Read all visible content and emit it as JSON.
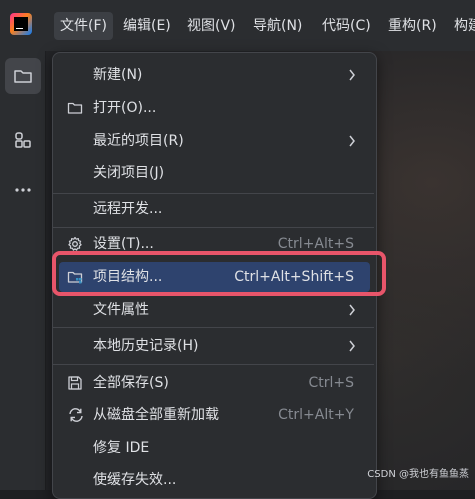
{
  "menubar": {
    "tabs": [
      "文件(F)",
      "编辑(E)",
      "视图(V)",
      "导航(N)",
      "代码(C)",
      "重构(R)",
      "构建"
    ]
  },
  "dropdown": {
    "items": [
      {
        "label": "新建(N)",
        "shortcut": "",
        "submenu": true,
        "icon": ""
      },
      {
        "label": "打开(O)...",
        "shortcut": "",
        "submenu": false,
        "icon": "folder-icon"
      },
      {
        "label": "最近的项目(R)",
        "shortcut": "",
        "submenu": true,
        "icon": ""
      },
      {
        "label": "关闭项目(J)",
        "shortcut": "",
        "submenu": false,
        "icon": ""
      },
      {
        "label": "远程开发...",
        "shortcut": "",
        "submenu": false,
        "icon": ""
      },
      {
        "label": "设置(T)...",
        "shortcut": "Ctrl+Alt+S",
        "submenu": false,
        "icon": "gear-icon"
      },
      {
        "label": "项目结构...",
        "shortcut": "Ctrl+Alt+Shift+S",
        "submenu": false,
        "icon": "project-structure-icon"
      },
      {
        "label": "文件属性",
        "shortcut": "",
        "submenu": true,
        "icon": ""
      },
      {
        "label": "本地历史记录(H)",
        "shortcut": "",
        "submenu": true,
        "icon": ""
      },
      {
        "label": "全部保存(S)",
        "shortcut": "Ctrl+S",
        "submenu": false,
        "icon": "save-icon"
      },
      {
        "label": "从磁盘全部重新加载",
        "shortcut": "Ctrl+Alt+Y",
        "submenu": false,
        "icon": "reload-icon"
      },
      {
        "label": "修复 IDE",
        "shortcut": "",
        "submenu": false,
        "icon": ""
      },
      {
        "label": "使缓存失效...",
        "shortcut": "",
        "submenu": false,
        "icon": ""
      }
    ]
  },
  "watermark": "CSDN @我也有鱼鱼蒸",
  "colors": {
    "highlight": "#2e436e",
    "annotation_box": "#e8556a"
  }
}
